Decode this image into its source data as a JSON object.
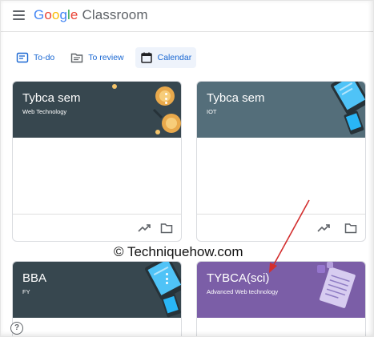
{
  "app": {
    "logo_word": [
      "G",
      "o",
      "o",
      "g",
      "l",
      "e"
    ],
    "product_name": "Classroom"
  },
  "nav": {
    "todo_label": "To-do",
    "review_label": "To review",
    "calendar_label": "Calendar"
  },
  "cards": [
    {
      "title": "Tybca sem",
      "subtitle": "Web Technology",
      "color": "#37474f"
    },
    {
      "title": "Tybca sem",
      "subtitle": "IOT",
      "color": "#546e7a"
    },
    {
      "title": "BBA",
      "subtitle": "FY",
      "color": "#37474f"
    },
    {
      "title": "TYBCA(sci)",
      "subtitle": "Advanced Web technology",
      "color": "#7b5ea7"
    }
  ],
  "watermark": "© Techniquehow.com",
  "help_label": "?",
  "colors": {
    "accent": "#1967d2",
    "arrow": "#d32f2f"
  },
  "icons": [
    "menu-icon",
    "todo-icon",
    "review-icon",
    "calendar-icon",
    "trending-icon",
    "folder-icon",
    "more-vert-icon",
    "help-icon"
  ]
}
